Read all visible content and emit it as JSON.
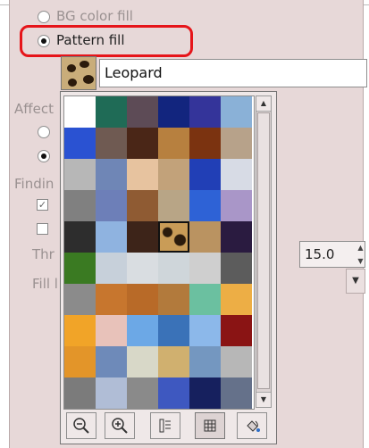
{
  "fill_type": {
    "bg_color_fill": "BG color fill",
    "pattern_fill": "Pattern fill",
    "selected": "pattern_fill"
  },
  "pattern": {
    "name": "Leopard"
  },
  "obscured_labels": {
    "affected": "Affect",
    "finding": "Findin",
    "threshold": "Thr",
    "fill_by": "Fill l"
  },
  "threshold_value": "15.0",
  "pattern_grid": {
    "colors": [
      "#ffffff",
      "#1f6b56",
      "#5d4b56",
      "#12257e",
      "#34349a",
      "#8ab1d7",
      "#2a52d2",
      "#6f5a52",
      "#4a2617",
      "#b7803f",
      "#7b3310",
      "#b7a28a",
      "#b7b7b7",
      "#6f86b6",
      "#e7c39f",
      "#c2a27a",
      "#213fb6",
      "#d7dbe5",
      "#808080",
      "#6d7fb8",
      "#8f5b33",
      "#b8a586",
      "#2e62d6",
      "#a996c8",
      "#2d2d2d",
      "#8fb3e0",
      "#3d2419",
      "#8f1c11",
      "#ba9361",
      "#2a1b40",
      "#3a7a22",
      "#c7d0da",
      "#d9dde1",
      "#cfd6da",
      "#cfcfcf",
      "#5c5c5c",
      "#8b8b8b",
      "#c7762e",
      "#b86a28",
      "#b27a3c",
      "#6bc0a0",
      "#edae45",
      "#f1a428",
      "#e8c2ba",
      "#6ca8e6",
      "#3a72b8",
      "#8cb8ea",
      "#8a1414",
      "#e39529",
      "#6e8ab9",
      "#d8d8c8",
      "#d0b06f",
      "#7497c0",
      "#b7b7b7",
      "#7b7b7b",
      "#b0bdd6",
      "#8a8a8a",
      "#3e58c0",
      "#16205e",
      "#65718a",
      "#111111",
      "#222222",
      "#c67a2e",
      "#7a5231",
      "#7a3b18",
      "#ffd400",
      "#b7905e",
      "#b7722b",
      "#c88b3d",
      "#d2a25a",
      "#8c9096",
      "#ffffff",
      "#ffffff",
      "#ffffff",
      "#ffffff",
      "#ffffff",
      "#ffffff",
      "#ffffff"
    ],
    "selected_index": 27
  },
  "toolbar": {
    "zoom_out": "zoom-out",
    "zoom_in": "zoom-in",
    "list_view": "list-view",
    "grid_view": "grid-view",
    "open_patterns": "open-patterns"
  }
}
